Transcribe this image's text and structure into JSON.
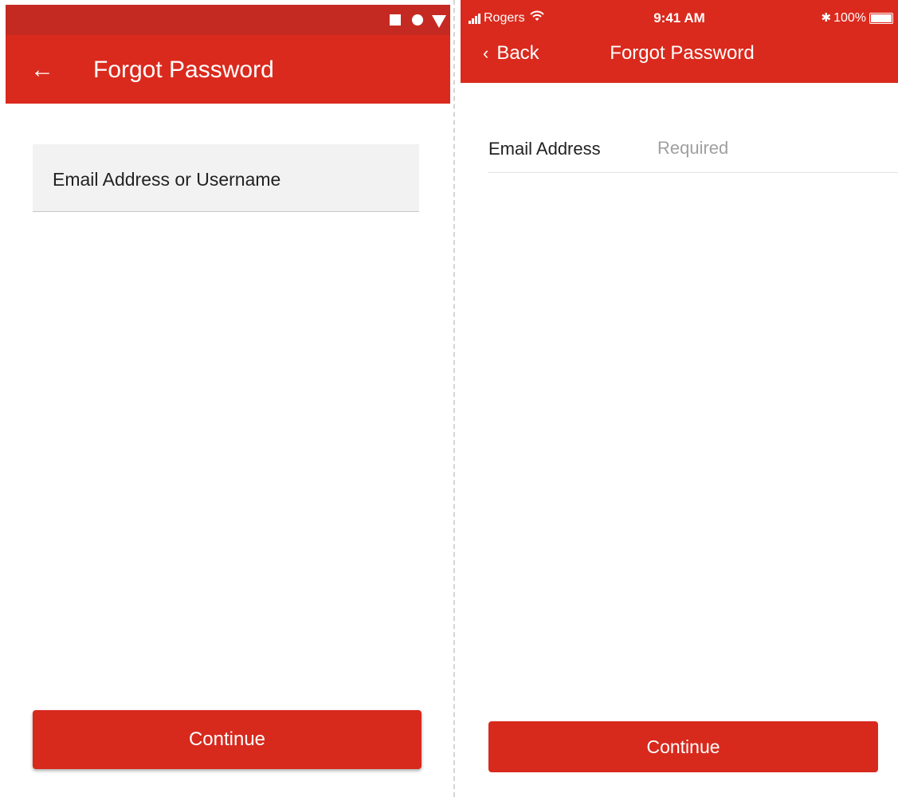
{
  "android": {
    "status_icons": [
      "stop-square-icon",
      "circle-icon",
      "triangle-down-icon"
    ],
    "appbar": {
      "back_icon": "arrow-left-icon",
      "back_glyph": "←",
      "title": "Forgot Password"
    },
    "field": {
      "label": "Email Address or Username"
    },
    "continue_button": {
      "label": "Continue"
    }
  },
  "ios": {
    "status_bar": {
      "carrier": "Rogers",
      "time": "9:41 AM",
      "bluetooth_glyph": "✱",
      "battery": "100%",
      "battery_level": 1.0
    },
    "navbar": {
      "back_glyph": "‹",
      "back_label": "Back",
      "title": "Forgot Password"
    },
    "email_row": {
      "label": "Email Address",
      "placeholder": "Required",
      "value": ""
    },
    "continue_button": {
      "label": "Continue"
    }
  },
  "colors": {
    "status_bar_android": "#c42a21",
    "brand_red": "#da2a1d",
    "field_background": "#f2f2f2",
    "placeholder_gray": "#a0a0a0"
  }
}
